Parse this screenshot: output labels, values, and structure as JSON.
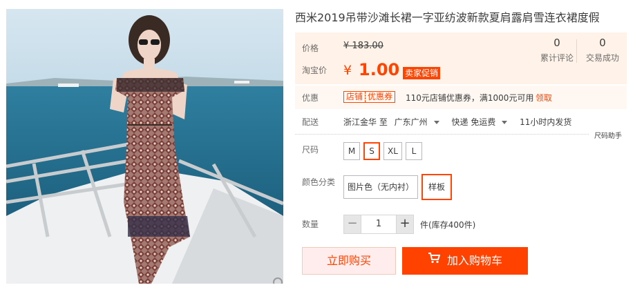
{
  "product": {
    "title": "西米2019吊带沙滩长裙一字亚纺波新款夏肩露肩雪连衣裙度假"
  },
  "price": {
    "label": "价格",
    "currency": "¥",
    "original": "183.00",
    "taobao_label": "淘宝价",
    "current": "1.00",
    "promo_badge": "卖家促销"
  },
  "stats": [
    {
      "count": "0",
      "label": "累计评论"
    },
    {
      "count": "0",
      "label": "交易成功"
    }
  ],
  "coupon": {
    "label": "优惠",
    "tag_left": "店铺",
    "tag_right": "优惠券",
    "description": "110元店铺优惠券，满1000元可用",
    "action": "领取"
  },
  "shipping": {
    "label": "配送",
    "from": "浙江金华 至",
    "to": "广东广州",
    "method": "快递 免运费",
    "dispatch": "11小时内发货"
  },
  "size": {
    "label": "尺码",
    "helper": "尺码助手",
    "options": [
      "M",
      "S",
      "XL",
      "L"
    ],
    "selected": "S"
  },
  "color": {
    "label": "颜色分类",
    "options": [
      "图片色（无内衬）",
      "样板"
    ],
    "selected": "样板"
  },
  "quantity": {
    "label": "数量",
    "value": "1",
    "minus": "−",
    "plus": "+",
    "stock": "件(库存400件)"
  },
  "actions": {
    "buy_now": "立即购买",
    "add_to_cart": "加入购物车"
  },
  "colors": {
    "accent": "#ff4400",
    "price_bg": "#fff2e8",
    "cart_button": "#ff4200"
  }
}
